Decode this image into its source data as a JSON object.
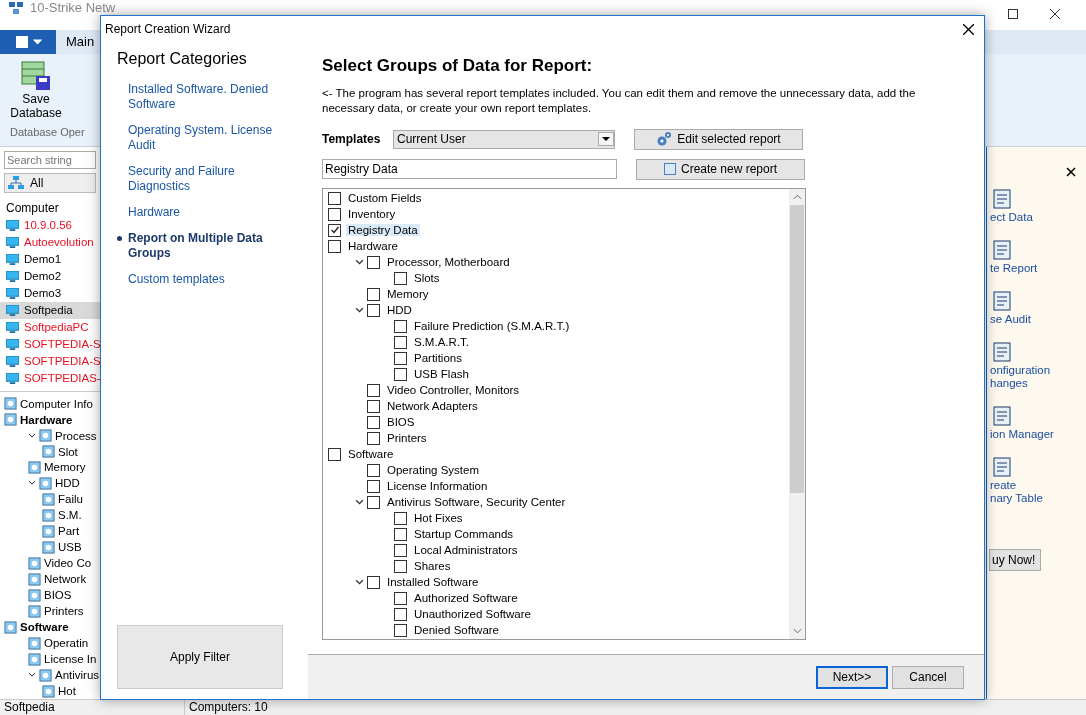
{
  "app": {
    "title": "10-Strike Netw",
    "menu_tab": "Main",
    "ribbon_buttons": [
      {
        "label": "Save Database"
      }
    ],
    "ribbon_group": "Database Oper",
    "search": {
      "placeholder": "Search string"
    },
    "filter_button": "All",
    "computer_header": "Computer",
    "computers": [
      {
        "name": "10.9.0.56",
        "color": "#e81123",
        "selected": false
      },
      {
        "name": "Autoevolution",
        "color": "#e81123",
        "selected": false
      },
      {
        "name": "Demo1",
        "color": "#000000",
        "selected": false
      },
      {
        "name": "Demo2",
        "color": "#000000",
        "selected": false
      },
      {
        "name": "Demo3",
        "color": "#000000",
        "selected": false
      },
      {
        "name": "Softpedia",
        "color": "#000000",
        "selected": true
      },
      {
        "name": "SoftpediaPC",
        "color": "#e81123",
        "selected": false
      },
      {
        "name": "SOFTPEDIA-S",
        "color": "#e81123",
        "selected": false
      },
      {
        "name": "SOFTPEDIA-S",
        "color": "#e81123",
        "selected": false
      },
      {
        "name": "SOFTPEDIAS-",
        "color": "#e81123",
        "selected": false
      }
    ],
    "info_tree": [
      {
        "label": "Computer Info",
        "kind": "item"
      },
      {
        "label": "Hardware",
        "kind": "group",
        "children": [
          {
            "label": "Process",
            "kind": "item",
            "expanded": true,
            "children": [
              {
                "label": "Slot",
                "kind": "item"
              }
            ]
          },
          {
            "label": "Memory",
            "kind": "item"
          },
          {
            "label": "HDD",
            "kind": "item",
            "expanded": true,
            "children": [
              {
                "label": "Failu",
                "kind": "item"
              },
              {
                "label": "S.M.",
                "kind": "item"
              },
              {
                "label": "Part",
                "kind": "item"
              },
              {
                "label": "USB",
                "kind": "item"
              }
            ]
          },
          {
            "label": "Video Co",
            "kind": "item"
          },
          {
            "label": "Network",
            "kind": "item"
          },
          {
            "label": "BIOS",
            "kind": "item"
          },
          {
            "label": "Printers",
            "kind": "item"
          }
        ]
      },
      {
        "label": "Software",
        "kind": "group",
        "children": [
          {
            "label": "Operatin",
            "kind": "item"
          },
          {
            "label": "License In",
            "kind": "item"
          },
          {
            "label": "Antivirus",
            "kind": "item",
            "expanded": true,
            "children": [
              {
                "label": "Hot",
                "kind": "item"
              }
            ]
          }
        ]
      }
    ],
    "tasks": [
      {
        "label": "ect Data"
      },
      {
        "label": "te Report"
      },
      {
        "label": "se Audit"
      },
      {
        "label": "onfiguration\nhanges"
      },
      {
        "label": "ion Manager"
      },
      {
        "label": "reate\nnary Table"
      }
    ],
    "buy_button": "uy Now!",
    "status_bar": [
      "Softpedia",
      "Computers: 10"
    ]
  },
  "dialog": {
    "title": "Report Creation Wizard",
    "categories_title": "Report Categories",
    "categories": [
      {
        "label": "Installed Software. Denied Software",
        "selected": false
      },
      {
        "label": "Operating System. License Audit",
        "selected": false
      },
      {
        "label": "Security and Failure Diagnostics",
        "selected": false
      },
      {
        "label": "Hardware",
        "selected": false
      },
      {
        "label": "Report on Multiple Data Groups",
        "selected": true
      },
      {
        "label": "Custom templates",
        "selected": false
      }
    ],
    "apply_button": "Apply Filter",
    "heading": "Select Groups of Data for Report:",
    "description": "<- The program has several report templates included. You can edit them and remove the unnecessary data, add the necessary data, or create your own report templates.",
    "templates_label": "Templates",
    "template_value": "Current User",
    "name_value": "Registry Data",
    "edit_button": "Edit selected report",
    "create_button": "Create new report",
    "tree": [
      {
        "label": "Custom Fields",
        "checked": false,
        "selected": false
      },
      {
        "label": "Inventory",
        "checked": false,
        "selected": false
      },
      {
        "label": "Registry Data",
        "checked": true,
        "selected": true
      },
      {
        "label": "Hardware",
        "checked": false,
        "selected": false,
        "children": [
          {
            "label": "Processor, Motherboard",
            "checked": false,
            "selected": false,
            "expanded": true,
            "children": [
              {
                "label": "Slots",
                "checked": false,
                "selected": false
              }
            ]
          },
          {
            "label": "Memory",
            "checked": false,
            "selected": false
          },
          {
            "label": "HDD",
            "checked": false,
            "selected": false,
            "expanded": true,
            "children": [
              {
                "label": "Failure Prediction (S.M.A.R.T.)",
                "checked": false,
                "selected": false
              },
              {
                "label": "S.M.A.R.T.",
                "checked": false,
                "selected": false
              },
              {
                "label": "Partitions",
                "checked": false,
                "selected": false
              },
              {
                "label": "USB Flash",
                "checked": false,
                "selected": false
              }
            ]
          },
          {
            "label": "Video Controller, Monitors",
            "checked": false,
            "selected": false
          },
          {
            "label": "Network Adapters",
            "checked": false,
            "selected": false
          },
          {
            "label": "BIOS",
            "checked": false,
            "selected": false
          },
          {
            "label": "Printers",
            "checked": false,
            "selected": false
          }
        ]
      },
      {
        "label": "Software",
        "checked": false,
        "selected": false,
        "children": [
          {
            "label": "Operating System",
            "checked": false,
            "selected": false
          },
          {
            "label": "License Information",
            "checked": false,
            "selected": false
          },
          {
            "label": "Antivirus Software, Security Center",
            "checked": false,
            "selected": false,
            "expanded": true,
            "children": [
              {
                "label": "Hot Fixes",
                "checked": false,
                "selected": false
              },
              {
                "label": "Startup Commands",
                "checked": false,
                "selected": false
              },
              {
                "label": "Local Administrators",
                "checked": false,
                "selected": false
              },
              {
                "label": "Shares",
                "checked": false,
                "selected": false
              }
            ]
          },
          {
            "label": "Installed Software",
            "checked": false,
            "selected": false,
            "expanded": true,
            "children": [
              {
                "label": "Authorized Software",
                "checked": false,
                "selected": false
              },
              {
                "label": "Unauthorized Software",
                "checked": false,
                "selected": false
              },
              {
                "label": "Denied Software",
                "checked": false,
                "selected": false
              }
            ]
          }
        ]
      }
    ],
    "next_button": "Next>>",
    "cancel_button": "Cancel"
  }
}
